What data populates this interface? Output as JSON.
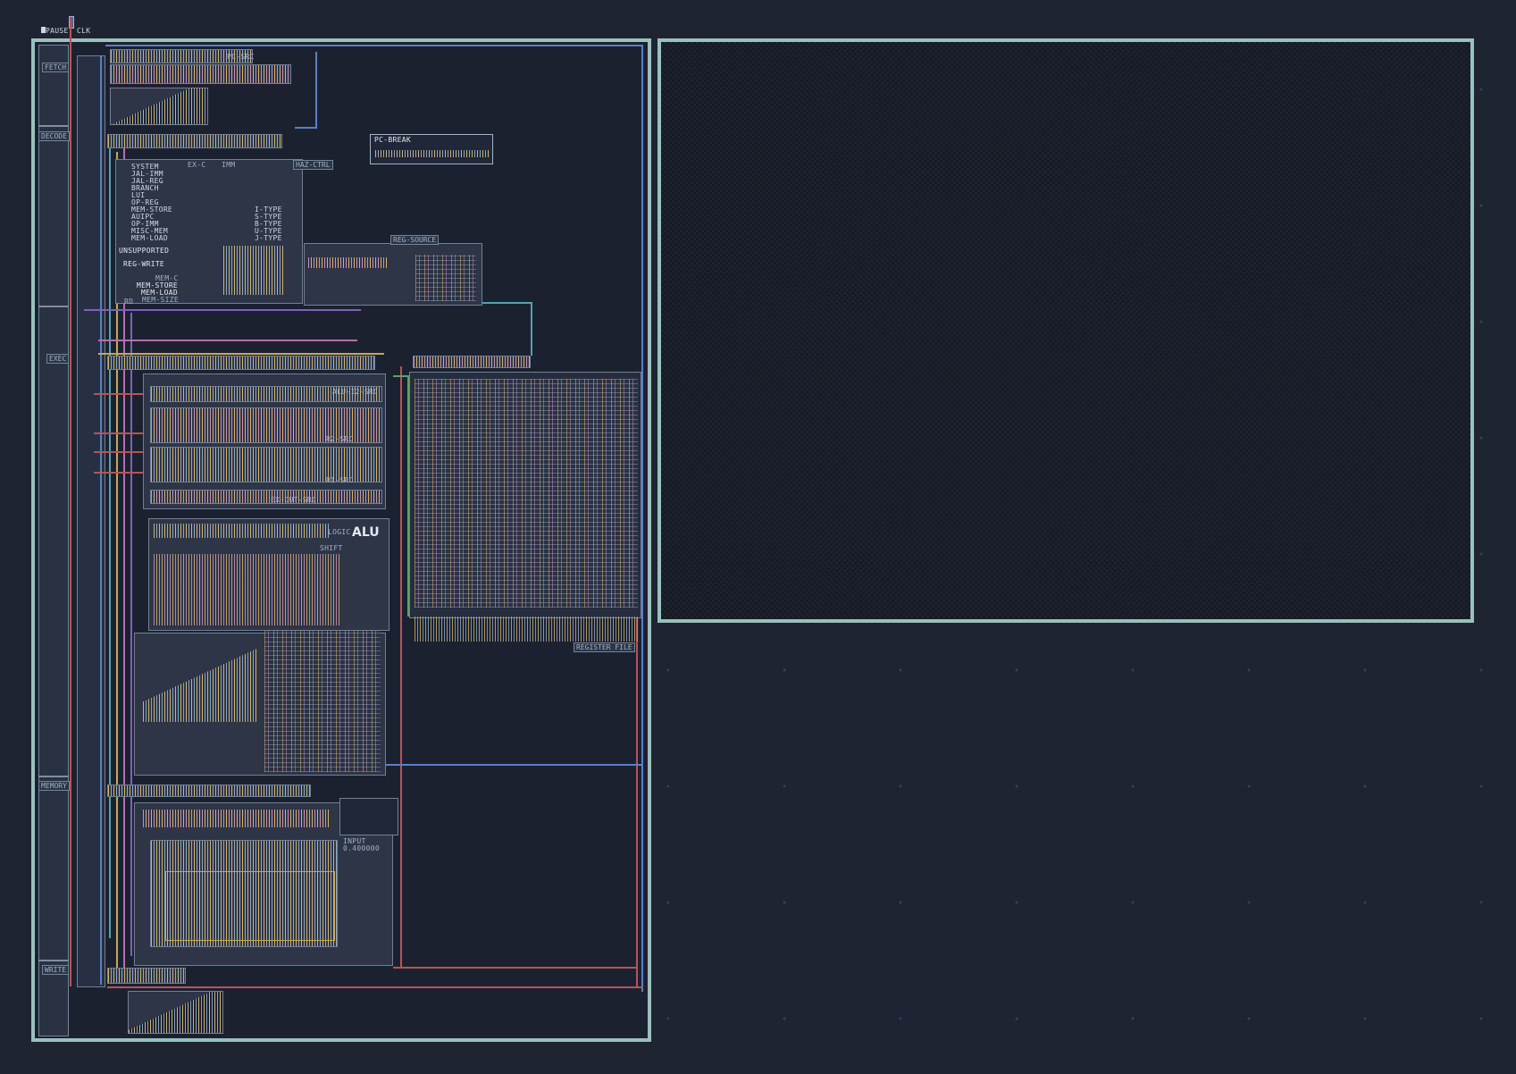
{
  "controls": {
    "pause_label": "PAUSE",
    "clk_label": "CLK"
  },
  "stages": {
    "fetch": "FETCH",
    "decode": "DECODE",
    "exec": "EXEC",
    "memory": "MEMORY",
    "write": "WRITE"
  },
  "fetch": {
    "pc_src": "PC-SRC"
  },
  "pc_break": {
    "label": "PC-BREAK"
  },
  "decode": {
    "ex_c": "EX-C",
    "imm": "IMM",
    "haz_ctrl": "HAZ-CTRL",
    "opcodes": [
      "SYSTEM",
      "JAL-IMM",
      "JAL-REG",
      "BRANCH",
      "LUI",
      "OP-REG",
      "MEM-STORE",
      "AUIPC",
      "OP-IMM",
      "MISC-MEM",
      "MEM-LOAD"
    ],
    "types": [
      "I-TYPE",
      "S-TYPE",
      "B-TYPE",
      "U-TYPE",
      "J-TYPE"
    ],
    "unsupported": "UNSUPPORTED",
    "reg_write": "REG-WRITE",
    "mem_c": "MEM-C",
    "mem_store": "MEM-STORE",
    "mem_load": "MEM-LOAD",
    "rd": "RD",
    "mem_size": "MEM-SIZE",
    "reg_source": "REG-SOURCE"
  },
  "exec": {
    "alu_i2_src": "ALU-I2-SRC",
    "r2_src": "R2-SRC",
    "r1_src": "R1-SRC",
    "ex_out_src": "EX-OUT-SRC",
    "logic": "LOGIC",
    "alu": "ALU",
    "shift": "SHIFT"
  },
  "register_file": {
    "label": "REGISTER FILE"
  },
  "memory": {
    "input_label": "INPUT",
    "input_value": "0.400000"
  },
  "colors": {
    "board_border": "#9bc0bd",
    "background": "#1f2432",
    "wire_blue": "#5a7fc4",
    "wire_red": "#b65555"
  }
}
